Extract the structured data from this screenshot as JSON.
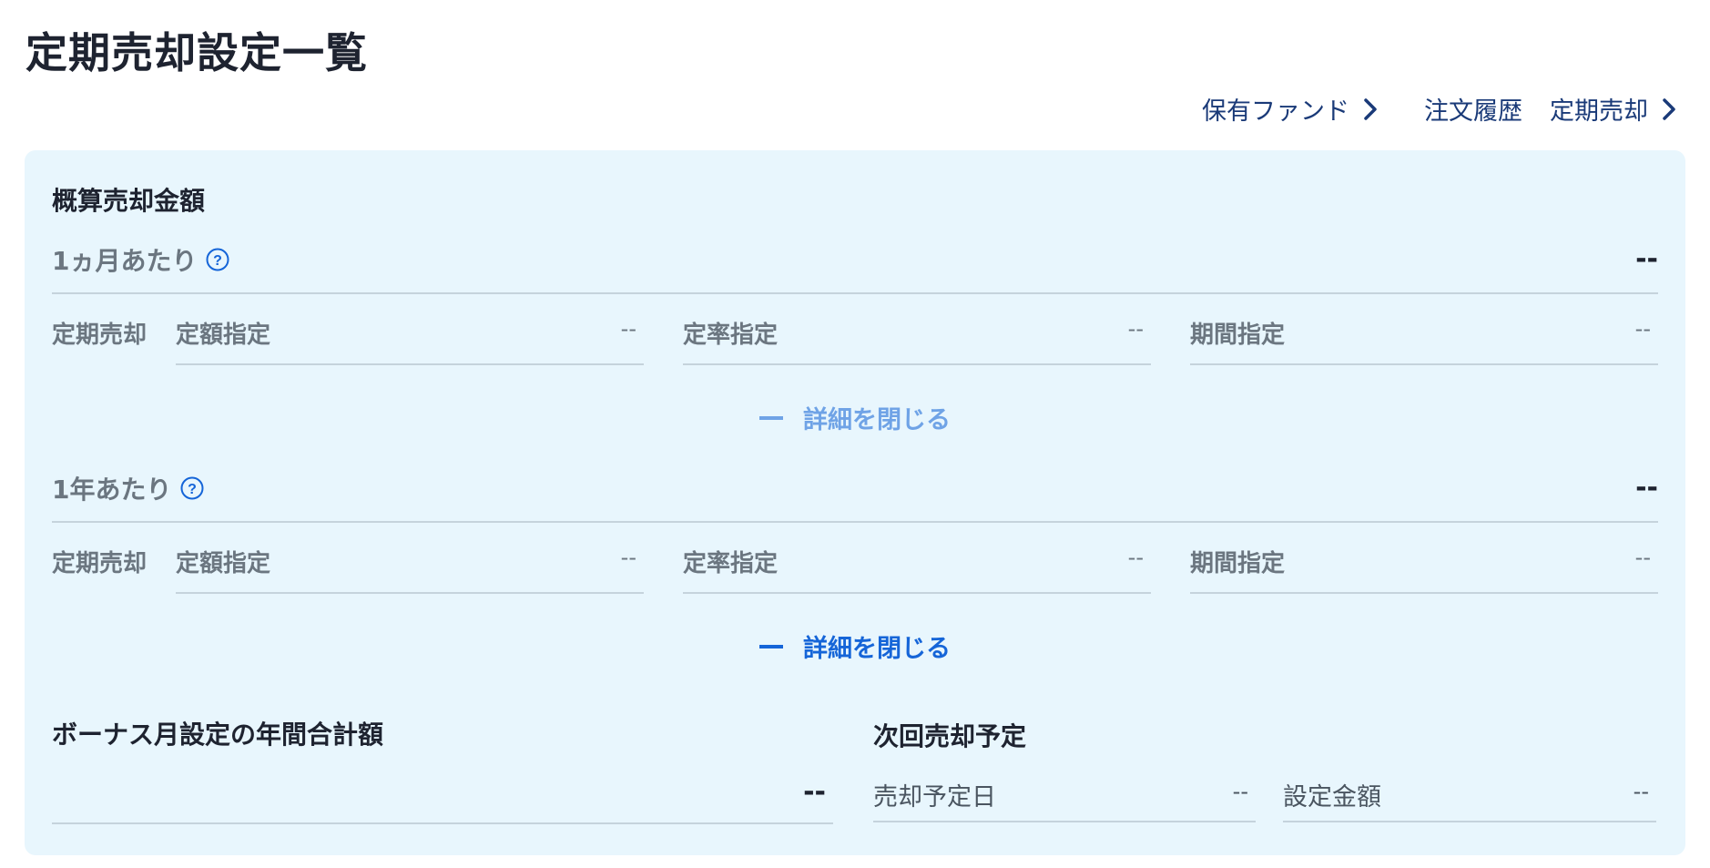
{
  "page_title": "定期売却設定一覧",
  "nav": {
    "holdings": "保有ファンド",
    "order_history": "注文履歴",
    "periodic_sale": "定期売却"
  },
  "estimate": {
    "heading": "概算売却金額",
    "monthly": {
      "label": "1ヵ月あたり",
      "value": "--",
      "row_label": "定期売却",
      "fixed_amount_label": "定額指定",
      "fixed_amount_value": "--",
      "fixed_rate_label": "定率指定",
      "fixed_rate_value": "--",
      "period_label": "期間指定",
      "period_value": "--",
      "toggle_label": "詳細を閉じる"
    },
    "yearly": {
      "label": "1年あたり",
      "value": "--",
      "row_label": "定期売却",
      "fixed_amount_label": "定額指定",
      "fixed_amount_value": "--",
      "fixed_rate_label": "定率指定",
      "fixed_rate_value": "--",
      "period_label": "期間指定",
      "period_value": "--",
      "toggle_label": "詳細を閉じる"
    }
  },
  "bonus": {
    "heading": "ボーナス月設定の年間合計額",
    "value": "--"
  },
  "next_sale": {
    "heading": "次回売却予定",
    "date_label": "売却予定日",
    "date_value": "--",
    "amount_label": "設定金額",
    "amount_value": "--"
  },
  "icons": {
    "nav_chevron": "chevron-right-icon",
    "help": "question-circle-icon",
    "toggle": "minus-icon"
  },
  "colors": {
    "panel_bg": "#e8f6fd",
    "link": "#1a3a78",
    "accent": "#1565d8",
    "accent_faded": "#6fa3e6"
  }
}
